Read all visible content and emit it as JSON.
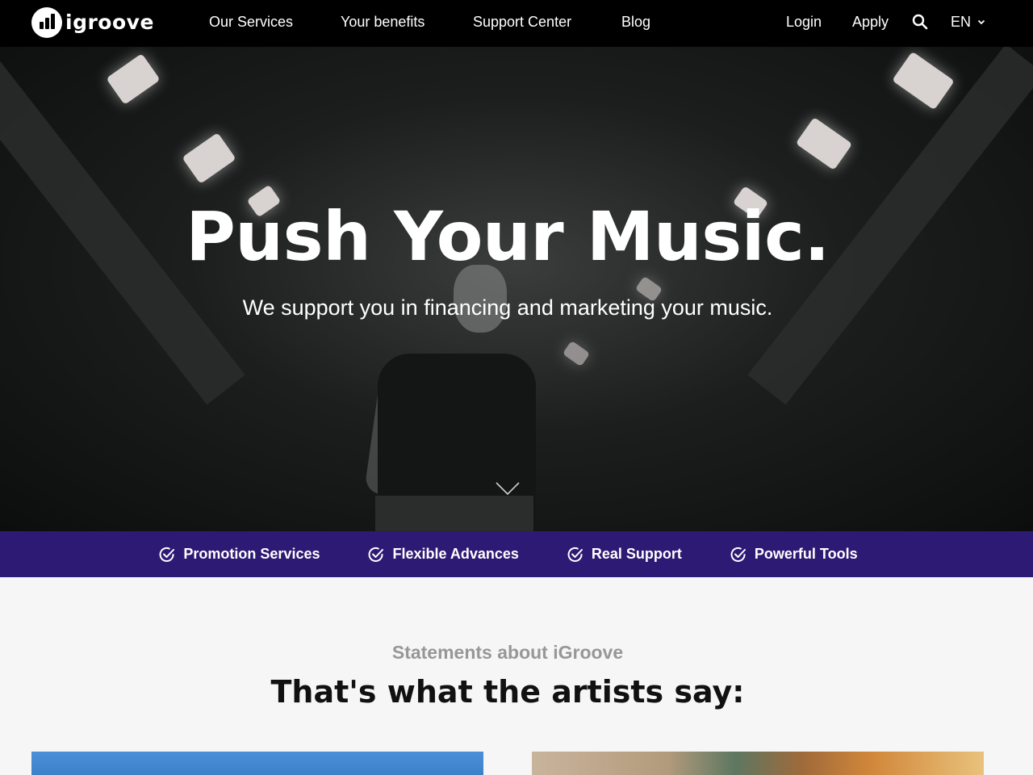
{
  "header": {
    "brand": "igroove",
    "nav_items": [
      {
        "label": "Our Services"
      },
      {
        "label": "Your benefits"
      },
      {
        "label": "Support Center"
      },
      {
        "label": "Blog"
      }
    ],
    "login_label": "Login",
    "apply_label": "Apply",
    "search_icon": "search-icon",
    "language": "EN"
  },
  "hero": {
    "title": "Push Your Music.",
    "subtitle": "We support you in financing and marketing your music.",
    "scroll_icon": "chevron-down-icon"
  },
  "features": [
    {
      "label": "Promotion Services",
      "icon": "check-circle-icon"
    },
    {
      "label": "Flexible Advances",
      "icon": "check-circle-icon"
    },
    {
      "label": "Real Support",
      "icon": "check-circle-icon"
    },
    {
      "label": "Powerful Tools",
      "icon": "check-circle-icon"
    }
  ],
  "testimonials": {
    "eyebrow": "Statements about iGroove",
    "title": "That's what the artists say:"
  },
  "colors": {
    "nav_bg": "#000000",
    "feature_bar_bg": "#2d1a74",
    "page_bg": "#f6f6f6",
    "eyebrow_text": "#979797"
  }
}
